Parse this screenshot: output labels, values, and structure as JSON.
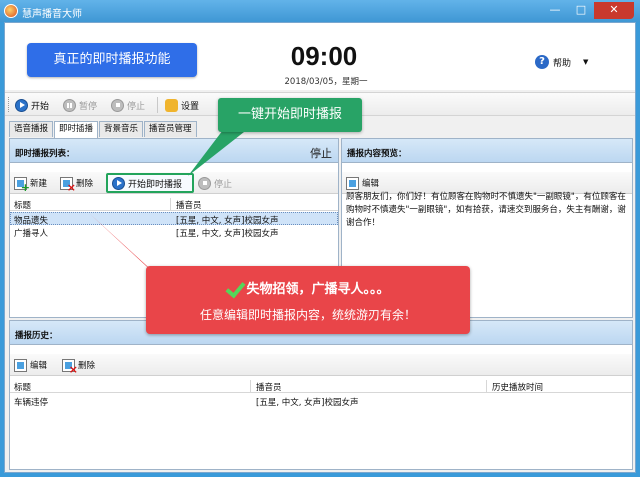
{
  "window": {
    "title": "慧声播音大师",
    "controls": [
      "—",
      "□",
      "✕"
    ]
  },
  "header": {
    "promo": "真正的即时播报功能",
    "clock": "09:00",
    "date": "2018/03/05，星期一",
    "help": "帮助"
  },
  "toolbar": {
    "start": "开始",
    "pause": "暂停",
    "stop": "停止",
    "settings": "设置"
  },
  "tabs": [
    "语音播报",
    "即时插播",
    "背景音乐",
    "播音员管理"
  ],
  "instant": {
    "title": "即时播报列表：",
    "status": "停止",
    "new": "新建",
    "delete": "删除",
    "start_broadcast": "开始即时播报",
    "stop": "停止",
    "columns": [
      "标题",
      "播音员"
    ],
    "rows": [
      {
        "title": "物品遗失",
        "announcer": "[五星, 中文, 女声]校园女声"
      },
      {
        "title": "广播寻人",
        "announcer": "[五星, 中文, 女声]校园女声"
      }
    ]
  },
  "preview": {
    "title": "播报内容预览：",
    "edit": "编辑",
    "text": "顾客朋友们，你们好！有位顾客在购物时不慎遗失\"一副眼镜\"，有位顾客在购物时不慎遗失\"一副眼镜\"，如有拾获，请速交到服务台，失主有酬谢，谢谢合作！"
  },
  "history": {
    "title": "播报历史：",
    "edit": "编辑",
    "delete": "删除",
    "columns": [
      "标题",
      "播音员",
      "历史播放时间"
    ],
    "rows": [
      {
        "title": "车辆违停",
        "announcer": "[五星, 中文, 女声]校园女声",
        "time": ""
      }
    ]
  },
  "callouts": {
    "green": "一键开始即时播报",
    "red_line1": "失物招领，广播寻人。。。",
    "red_line2": "任意编辑即时播报内容，统统游刃有余！"
  },
  "colors": {
    "accent_blue": "#2f6ee8",
    "callout_green": "#28a366",
    "callout_red": "#e94549"
  }
}
